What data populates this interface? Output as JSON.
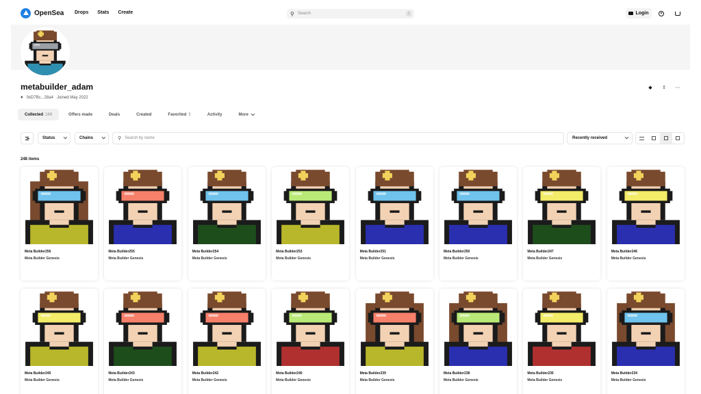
{
  "header": {
    "logo_text": "OpenSea",
    "nav": [
      "Drops",
      "Stats",
      "Create"
    ],
    "search_placeholder": "Search",
    "search_shortcut": "/",
    "login_label": "Login"
  },
  "profile": {
    "name": "metabuilder_adam",
    "address": "0xD7Bc...28a4",
    "joined": "Joined May 2022"
  },
  "tabs": [
    {
      "label": "Collected",
      "count": "248",
      "active": true
    },
    {
      "label": "Offers made",
      "count": ""
    },
    {
      "label": "Deals",
      "count": ""
    },
    {
      "label": "Created",
      "count": ""
    },
    {
      "label": "Favorited",
      "count": "5"
    },
    {
      "label": "Activity",
      "count": ""
    },
    {
      "label": "More",
      "count": ""
    }
  ],
  "filters": {
    "status_label": "Status",
    "chains_label": "Chains",
    "search_placeholder": "Search by name",
    "sort_label": "Recently received"
  },
  "items_count": "248 items",
  "colors": {
    "brand": "#2081e2",
    "skin": "#f3d2b4",
    "outline": "#1b1b1b"
  },
  "items": [
    {
      "name": "Meta Builder256",
      "collection": "Meta Builder Genesis",
      "hair": "long",
      "visor": "#6fc3ec",
      "shirt": "#b8b62a"
    },
    {
      "name": "Meta Builder255",
      "collection": "Meta Builder Genesis",
      "hair": "short",
      "visor": "#f6806a",
      "shirt": "#2a2fb0"
    },
    {
      "name": "Meta Builder254",
      "collection": "Meta Builder Genesis",
      "hair": "short",
      "visor": "#6fc3ec",
      "shirt": "#1e4d1c"
    },
    {
      "name": "Meta Builder253",
      "collection": "Meta Builder Genesis",
      "hair": "short",
      "visor": "#b9ea77",
      "shirt": "#b8b62a"
    },
    {
      "name": "Meta Builder251",
      "collection": "Meta Builder Genesis",
      "hair": "short",
      "visor": "#6fc3ec",
      "shirt": "#2a2fb0"
    },
    {
      "name": "Meta Builder250",
      "collection": "Meta Builder Genesis",
      "hair": "short",
      "visor": "#6fc3ec",
      "shirt": "#2a2fb0"
    },
    {
      "name": "Meta Builder247",
      "collection": "Meta Builder Genesis",
      "hair": "short",
      "visor": "#f3ec68",
      "shirt": "#1e4d1c"
    },
    {
      "name": "Meta Builder246",
      "collection": "Meta Builder Genesis",
      "hair": "short",
      "visor": "#f3ec68",
      "shirt": "#2a2fb0"
    },
    {
      "name": "Meta Builder245",
      "collection": "Meta Builder Genesis",
      "hair": "short",
      "visor": "#f3ec68",
      "shirt": "#b8b62a"
    },
    {
      "name": "Meta Builder243",
      "collection": "Meta Builder Genesis",
      "hair": "short",
      "visor": "#f6806a",
      "shirt": "#1e4d1c"
    },
    {
      "name": "Meta Builder242",
      "collection": "Meta Builder Genesis",
      "hair": "short",
      "visor": "#f6806a",
      "shirt": "#b8b62a"
    },
    {
      "name": "Meta Builder240",
      "collection": "Meta Builder Genesis",
      "hair": "short",
      "visor": "#b9ea77",
      "shirt": "#b03030"
    },
    {
      "name": "Meta Builder239",
      "collection": "Meta Builder Genesis",
      "hair": "long",
      "visor": "#f6806a",
      "shirt": "#b8b62a"
    },
    {
      "name": "Meta Builder238",
      "collection": "Meta Builder Genesis",
      "hair": "long",
      "visor": "#b9ea77",
      "shirt": "#2a2fb0"
    },
    {
      "name": "Meta Builder235",
      "collection": "Meta Builder Genesis",
      "hair": "short",
      "visor": "#f3ec68",
      "shirt": "#b03030"
    },
    {
      "name": "Meta Builder234",
      "collection": "Meta Builder Genesis",
      "hair": "long",
      "visor": "#6fc3ec",
      "shirt": "#2a2fb0"
    }
  ]
}
